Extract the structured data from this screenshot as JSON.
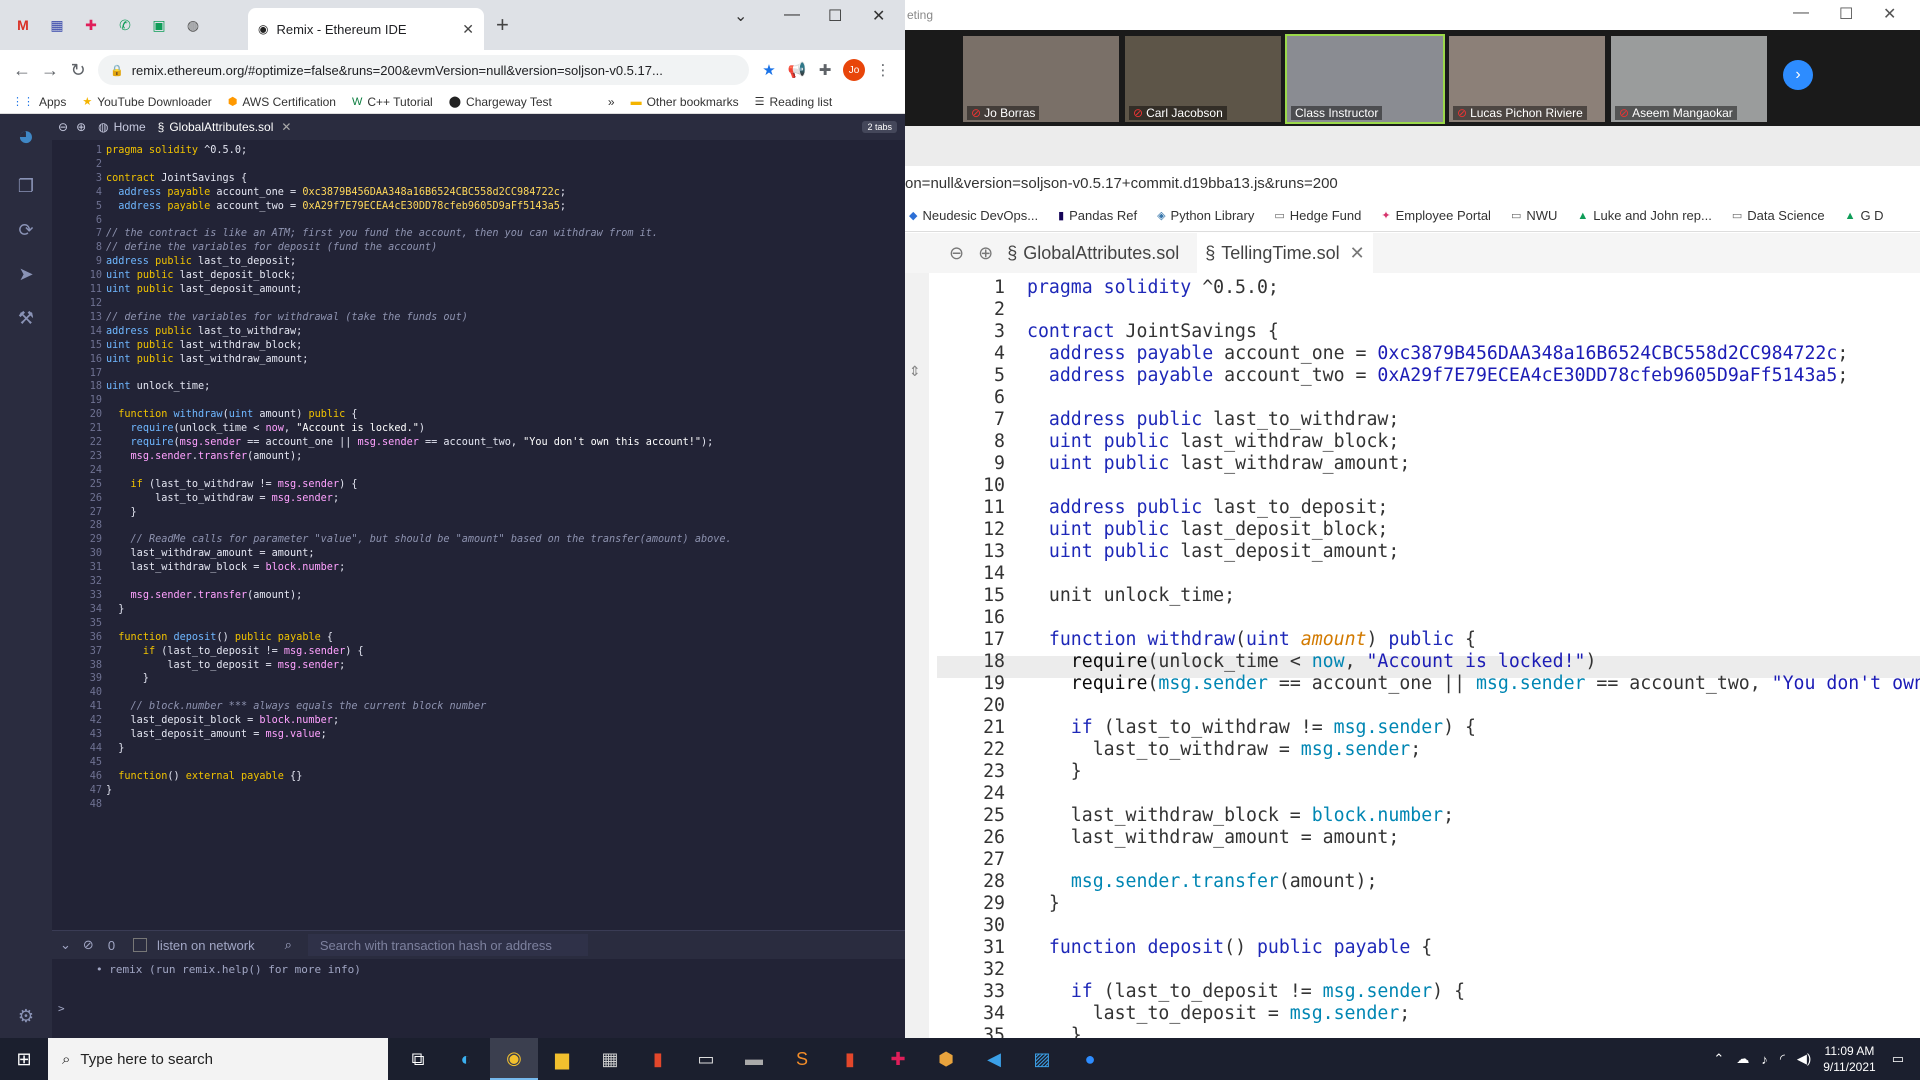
{
  "left_browser": {
    "tab_title": "Remix - Ethereum IDE",
    "url": "remix.ethereum.org/#optimize=false&runs=200&evmVersion=null&version=soljson-v0.5.17...",
    "avatar_initials": "Jo",
    "bookmarks": [
      "Apps",
      "YouTube Downloader",
      "AWS Certification",
      "C++ Tutorial",
      "Chargeway Test",
      "»",
      "Other bookmarks",
      "Reading list"
    ]
  },
  "remix_left": {
    "tabs": [
      "Home",
      "GlobalAttributes.sol"
    ],
    "tabs_count": "2 tabs",
    "line_count": 48,
    "terminal": {
      "count": "0",
      "listen_label": "listen on network",
      "search_placeholder": "Search with transaction hash or address",
      "output_line": "remix (run remix.help() for more info)",
      "prompt": ">"
    }
  },
  "zoom": {
    "title": "eting",
    "participants": [
      "Jo Borras",
      "Carl Jacobson",
      "Class Instructor",
      "Lucas Pichon Riviere",
      "Aseem Mangaokar"
    ]
  },
  "right_browser": {
    "url": "on=null&version=soljson-v0.5.17+commit.d19bba13.js&runs=200",
    "bookmarks": [
      "Neudesic DevOps...",
      "Pandas Ref",
      "Python Library",
      "Hedge Fund",
      "Employee Portal",
      "NWU",
      "Luke and John rep...",
      "Data Science",
      "G D"
    ],
    "tabs": [
      "GlobalAttributes.sol",
      "TellingTime.sol"
    ],
    "line_count": 35
  },
  "taskbar": {
    "search_placeholder": "Type here to search",
    "time": "11:09 AM",
    "date": "9/11/2021"
  }
}
